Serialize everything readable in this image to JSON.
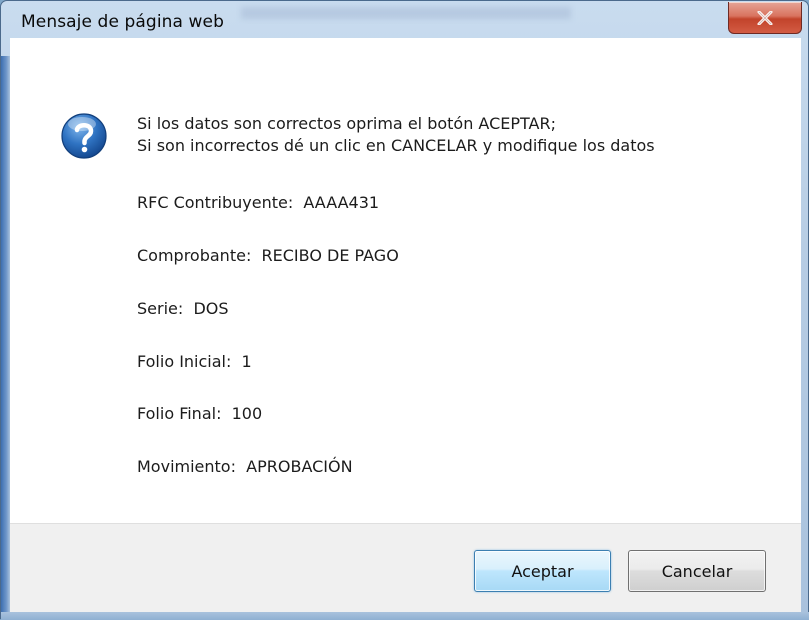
{
  "window": {
    "title": "Mensaje de página web",
    "close_symbol": "x"
  },
  "message": {
    "line1": "Si los datos son correctos oprima el botón ACEPTAR;",
    "line2": "Si son incorrectos dé un clic en CANCELAR y modifique los datos"
  },
  "fields": [
    {
      "label": "RFC Contribuyente:",
      "value": "AAAA431"
    },
    {
      "label": "Comprobante:",
      "value": "RECIBO DE PAGO"
    },
    {
      "label": "Serie:",
      "value": "DOS"
    },
    {
      "label": "Folio Inicial:",
      "value": "1"
    },
    {
      "label": "Folio Final:",
      "value": "100"
    },
    {
      "label": "Movimiento:",
      "value": "APROBACIÓN"
    }
  ],
  "buttons": {
    "accept_label": "Aceptar",
    "cancel_label": "Cancelar"
  },
  "icons": {
    "question": "question-icon",
    "close": "close-icon"
  },
  "colors": {
    "accept_border": "#3c7fb1",
    "close_red": "#c2432b",
    "icon_blue": "#1f5ea8"
  }
}
